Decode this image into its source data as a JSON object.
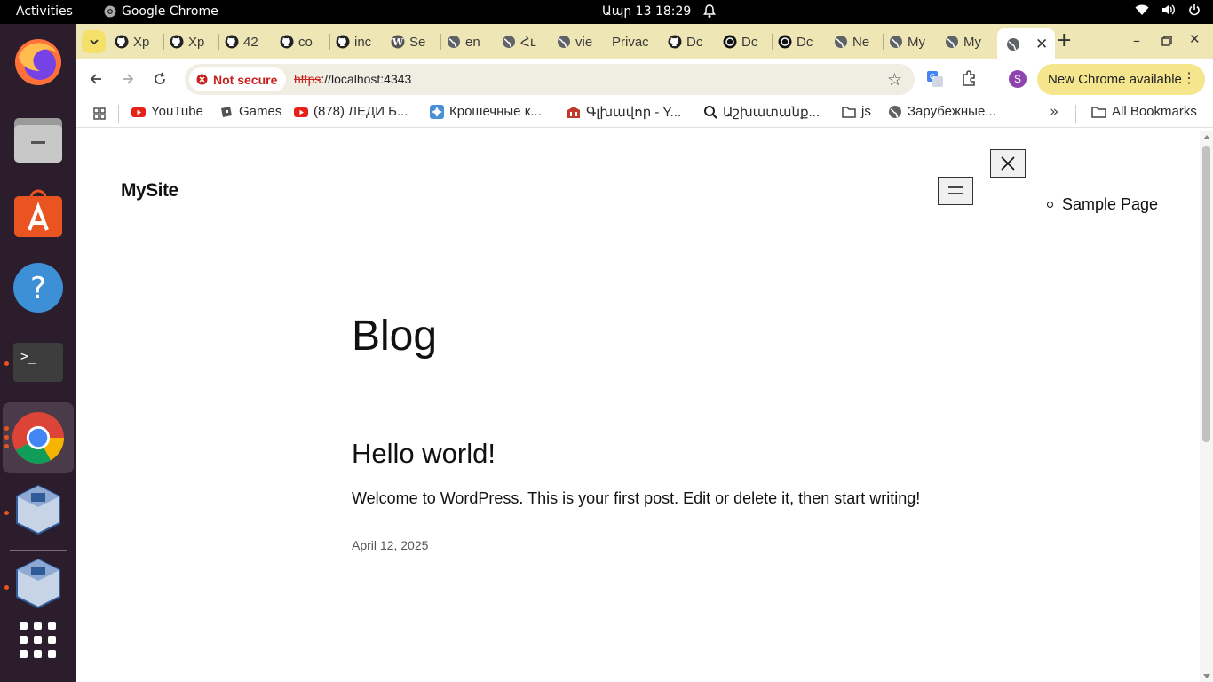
{
  "system": {
    "activities_label": "Activities",
    "app_name": "Google Chrome",
    "clock": "Ապր 13  18:29"
  },
  "dock": {
    "items": [
      "firefox-icon",
      "files-icon",
      "app-center-icon",
      "help-icon",
      "terminal-icon",
      "chrome-icon",
      "virtualbox-icon",
      "virtualbox-icon",
      "show-apps-icon"
    ]
  },
  "tabs": [
    {
      "label": "Xp",
      "icon": "github-icon"
    },
    {
      "label": "Xp",
      "icon": "github-icon"
    },
    {
      "label": "42",
      "icon": "github-icon"
    },
    {
      "label": "co",
      "icon": "github-icon"
    },
    {
      "label": "inc",
      "icon": "github-icon"
    },
    {
      "label": "Se",
      "icon": "wordpress-icon"
    },
    {
      "label": "en",
      "icon": "globe-icon"
    },
    {
      "label": "Հւ",
      "icon": "globe-icon"
    },
    {
      "label": "vie",
      "icon": "globe-icon"
    },
    {
      "label": "Privac",
      "icon": ""
    },
    {
      "label": "Dc",
      "icon": "github-icon"
    },
    {
      "label": "Dc",
      "icon": "openai-icon"
    },
    {
      "label": "Dc",
      "icon": "openai-icon"
    },
    {
      "label": "Ne",
      "icon": "globe-icon"
    },
    {
      "label": "My",
      "icon": "globe-icon"
    },
    {
      "label": "My",
      "icon": "globe-icon"
    }
  ],
  "toolbar": {
    "security_label": "Not secure",
    "url_scheme": "https",
    "url_rest": "://localhost:4343",
    "profile_initial": "S",
    "update_label": "New Chrome available"
  },
  "bookmarks": [
    {
      "label": "YouTube",
      "icon": "youtube-icon"
    },
    {
      "label": "Games",
      "icon": "games-icon"
    },
    {
      "label": "(878) ЛЕДИ Б...",
      "icon": "youtube-icon"
    },
    {
      "label": "Крошечные к...",
      "icon": "puzzle-icon"
    },
    {
      "label": "Գլխավոր - Y...",
      "icon": "building-icon"
    },
    {
      "label": "Աշխատանք...",
      "icon": "search-icon"
    },
    {
      "label": "js",
      "icon": "folder-icon"
    },
    {
      "label": "Зарубежные...",
      "icon": "globe-icon"
    }
  ],
  "all_bookmarks_label": "All Bookmarks",
  "page": {
    "site_title": "MySite",
    "nav_items": [
      "Sample Page"
    ],
    "heading": "Blog",
    "post": {
      "title": "Hello world!",
      "excerpt": "Welcome to WordPress. This is your first post. Edit or delete it, then start writing!",
      "date": "April 12, 2025"
    }
  },
  "colors": {
    "tabstrip_bg": "#efe6b5",
    "dock_bg": "#2b1d2b",
    "not_secure_red": "#c5221f",
    "update_pill": "#f5e58c"
  }
}
